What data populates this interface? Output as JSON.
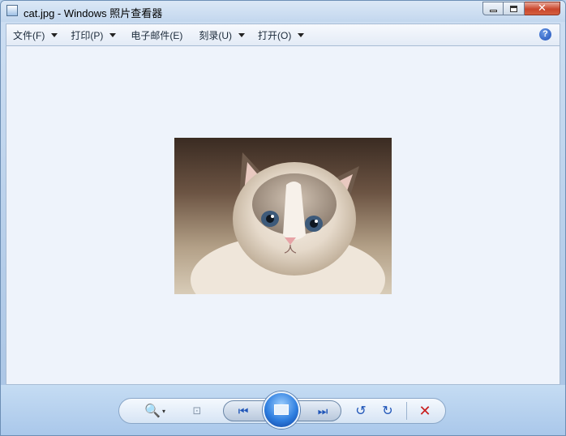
{
  "window": {
    "title": "cat.jpg - Windows 照片查看器",
    "close_glyph": "✕"
  },
  "menu": {
    "items": [
      {
        "label": "文件(F)",
        "has_arrow": true
      },
      {
        "label": "打印(P)",
        "has_arrow": true
      },
      {
        "label": "电子邮件(E)",
        "has_arrow": false
      },
      {
        "label": "刻录(U)",
        "has_arrow": true
      },
      {
        "label": "打开(O)",
        "has_arrow": true
      }
    ],
    "help_glyph": "?"
  },
  "toolbar": {
    "zoom_glyph": "🔍",
    "zoom_dropdown_glyph": "▾",
    "actual_size_glyph": "⊡",
    "prev_glyph": "⏮",
    "next_glyph": "⏭",
    "rotate_ccw_glyph": "↺",
    "rotate_cw_glyph": "↻",
    "delete_glyph": "✕"
  },
  "icons": [
    "photo-viewer-app-icon",
    "minimize-icon",
    "maximize-icon",
    "close-icon",
    "dropdown-arrow-icon",
    "help-icon",
    "zoom-icon",
    "actual-size-icon",
    "previous-icon",
    "slideshow-icon",
    "next-icon",
    "rotate-counterclockwise-icon",
    "rotate-clockwise-icon",
    "delete-icon"
  ],
  "colors": {
    "accent": "#1f55b8",
    "delete": "#c81d1d",
    "viewport_bg": "#eef3fb"
  }
}
